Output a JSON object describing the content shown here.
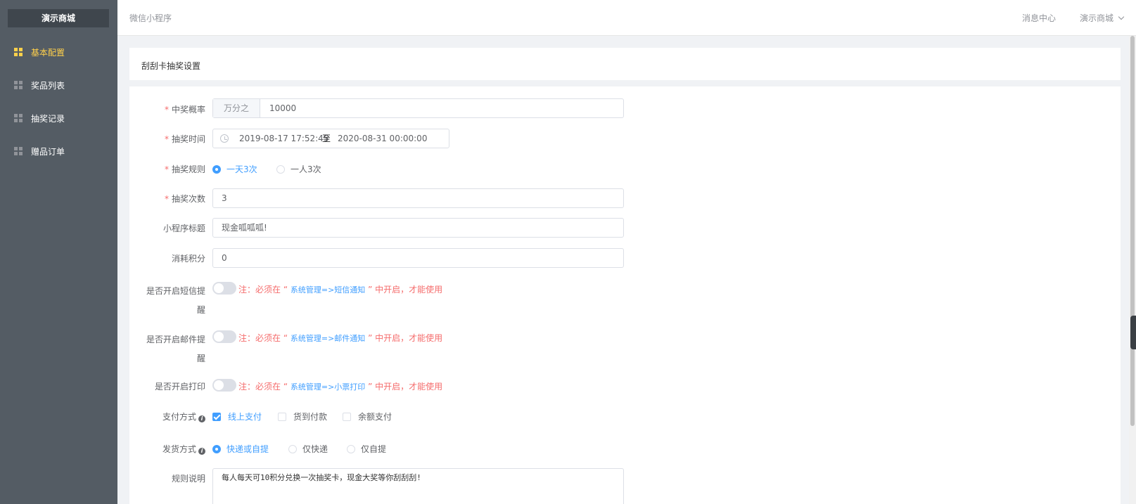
{
  "sidebar": {
    "brand": "演示商城",
    "items": [
      {
        "label": "基本配置",
        "active": true
      },
      {
        "label": "奖品列表",
        "active": false
      },
      {
        "label": "抽奖记录",
        "active": false
      },
      {
        "label": "赠品订单",
        "active": false
      }
    ]
  },
  "header": {
    "breadcrumb": "微信小程序",
    "message_center": "消息中心",
    "user_menu": "演示商城"
  },
  "page": {
    "title": "刮刮卡抽奖设置"
  },
  "form": {
    "probability": {
      "label": "中奖概率",
      "prepend": "万分之",
      "value": "10000"
    },
    "lottery_time": {
      "label": "抽奖时间",
      "start": "2019-08-17 17:52:45",
      "separator": "至",
      "end": "2020-08-31 00:00:00"
    },
    "rule": {
      "label": "抽奖规则",
      "options": [
        "一天3次",
        "一人3次"
      ],
      "selected": "一天3次"
    },
    "times": {
      "label": "抽奖次数",
      "value": "3"
    },
    "mini_title": {
      "label": "小程序标题",
      "value": "现金呱呱呱!"
    },
    "points": {
      "label": "消耗积分",
      "value": "0"
    },
    "sms": {
      "label_line1": "是否开启短信提",
      "label_line2": "醒",
      "enabled": false,
      "note_prefix": "注：必须在",
      "note_link": "系统管理=>短信通知",
      "note_suffix": "中开启，才能使用"
    },
    "email": {
      "label_line1": "是否开启邮件提",
      "label_line2": "醒",
      "enabled": false,
      "note_prefix": "注：必须在",
      "note_link": "系统管理=>邮件通知",
      "note_suffix": "中开启，才能使用"
    },
    "print": {
      "label": "是否开启打印",
      "enabled": false,
      "note_prefix": "注：必须在",
      "note_link": "系统管理=>小票打印",
      "note_suffix": "中开启，才能使用"
    },
    "payment": {
      "label": "支付方式",
      "options": [
        "线上支付",
        "货到付款",
        "余额支付"
      ],
      "checked": [
        "线上支付"
      ]
    },
    "delivery": {
      "label": "发货方式",
      "options": [
        "快递或自提",
        "仅快递",
        "仅自提"
      ],
      "selected": "快递或自提"
    },
    "rules_desc": {
      "label": "规则说明",
      "value": "每人每天可10积分兑换一次抽奖卡，现金大奖等你刮刮刮!"
    }
  },
  "colors": {
    "sidebar_bg": "#545c64",
    "active": "#ffd04b",
    "primary": "#409eff",
    "danger": "#f56c6c"
  }
}
